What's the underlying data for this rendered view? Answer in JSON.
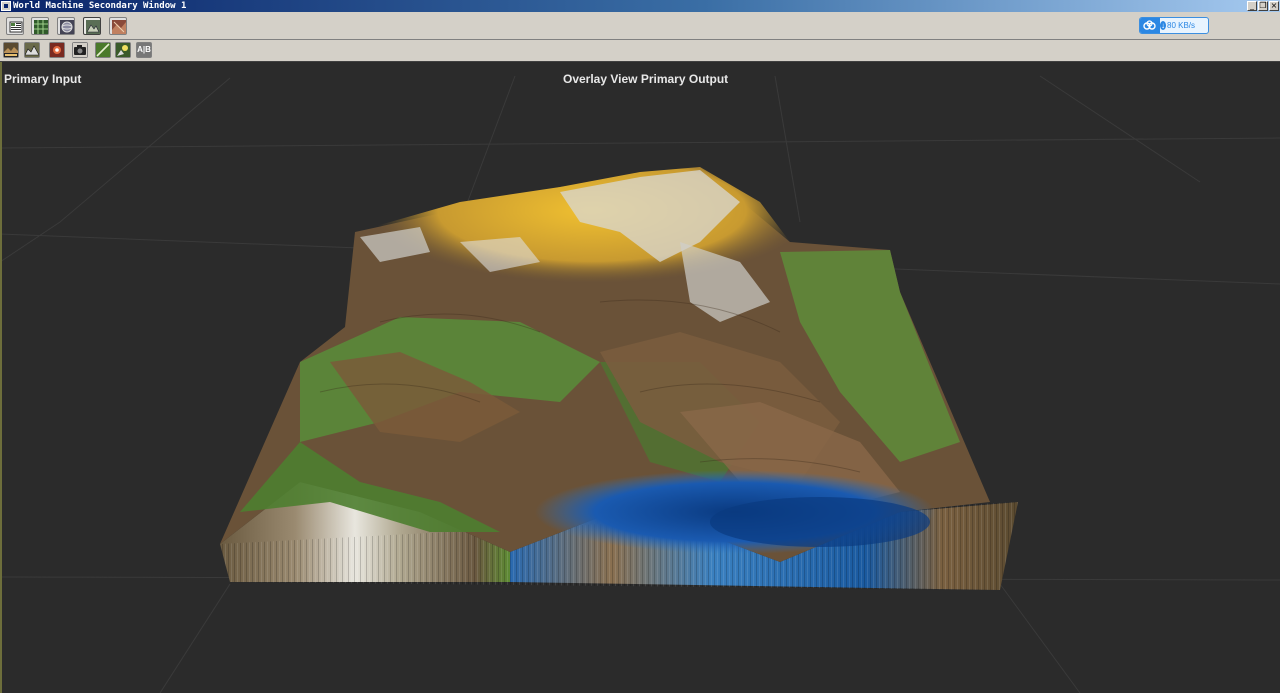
{
  "window": {
    "title": "World Machine Secondary Window 1",
    "controls": [
      "minimize-icon",
      "restore-icon",
      "close-icon"
    ]
  },
  "toolbar_main": {
    "buttons": [
      {
        "icon": "device-list-icon",
        "active": false
      },
      {
        "icon": "heightfield-grid-icon",
        "active": false
      },
      {
        "icon": "sphere-view-icon",
        "active": false
      },
      {
        "icon": "terrain-3d-view-icon",
        "active": true
      },
      {
        "icon": "texture-view-icon",
        "active": false
      }
    ]
  },
  "toolbar_view": {
    "buttons": [
      {
        "icon": "overlay-render-icon"
      },
      {
        "icon": "relief-icon"
      },
      {
        "icon": "scale-icon"
      },
      {
        "icon": "camera-icon"
      },
      {
        "icon": "slope-line-icon"
      },
      {
        "icon": "lighting-icon"
      },
      {
        "icon": "ab-compare-icon",
        "text": "A|B"
      }
    ]
  },
  "network_widget": {
    "speed": "80 KB/s",
    "icon": "cloud-download-icon",
    "accent": "#2b87e3"
  },
  "viewport": {
    "left_label": "Primary Input",
    "center_label": "Overlay View Primary Output",
    "background": "#2b2b2b"
  }
}
